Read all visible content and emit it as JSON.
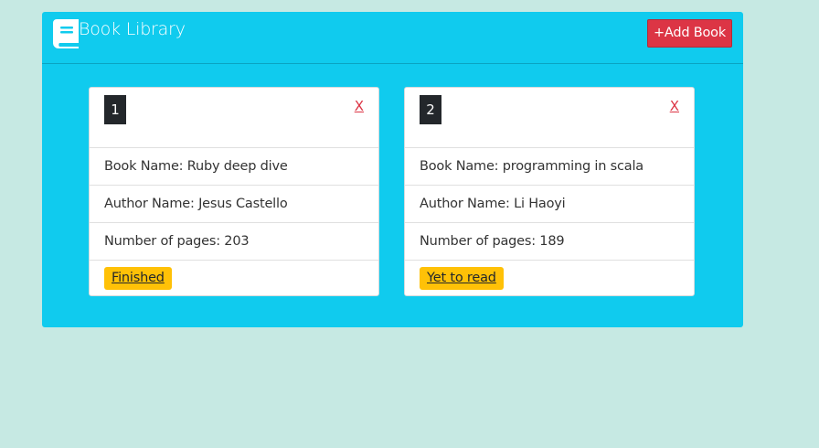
{
  "header": {
    "logo_icon": "book-icon",
    "title": "Book Library",
    "add_button": "+Add Book"
  },
  "books": [
    {
      "number": "1",
      "close": "X",
      "name": "Book Name: Ruby deep dive",
      "author": "Author Name: Jesus Castello",
      "pages": "Number of pages: 203",
      "status": "Finished"
    },
    {
      "number": "2",
      "close": "X",
      "name": "Book Name: programming in scala",
      "author": "Author Name: Li Haoyi",
      "pages": "Number of pages: 189",
      "status": "Yet to read"
    }
  ],
  "colors": {
    "page_bg": "#c6e9e3",
    "panel_bg": "#10cbee",
    "add_button_bg": "#dc3545",
    "status_bg": "#ffc107",
    "badge_bg": "#23272b"
  }
}
